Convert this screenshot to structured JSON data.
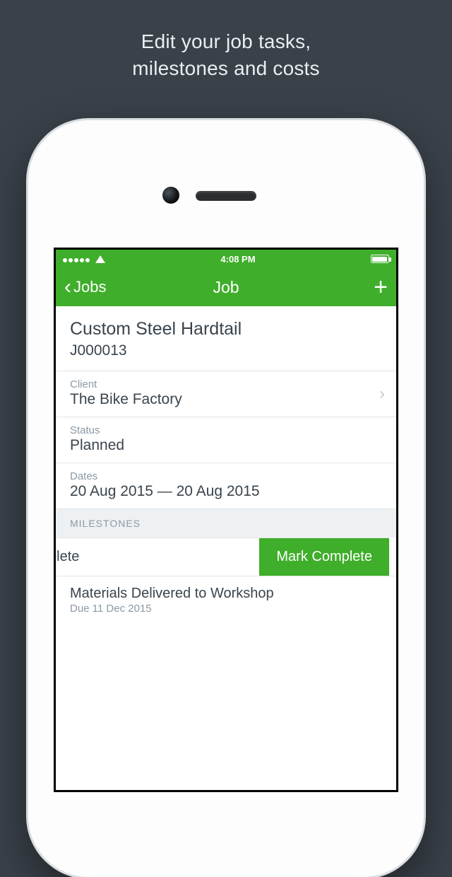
{
  "promo": {
    "line1": "Edit your job tasks,",
    "line2": "milestones and costs"
  },
  "status_bar": {
    "time": "4:08 PM"
  },
  "nav": {
    "back_label": "Jobs",
    "title": "Job",
    "add_label": "+"
  },
  "job": {
    "name": "Custom Steel Hardtail",
    "number": "J000013"
  },
  "fields": {
    "client_label": "Client",
    "client_value": "The Bike Factory",
    "status_label": "Status",
    "status_value": "Planned",
    "dates_label": "Dates",
    "dates_value": "20 Aug 2015 — 20 Aug 2015"
  },
  "sections": {
    "milestones_header": "MILESTONES"
  },
  "swipe": {
    "partial_text": "plete",
    "action_label": "Mark Complete"
  },
  "milestones": [
    {
      "title": "Materials Delivered to Workshop",
      "due": "Due 11 Dec 2015"
    }
  ]
}
